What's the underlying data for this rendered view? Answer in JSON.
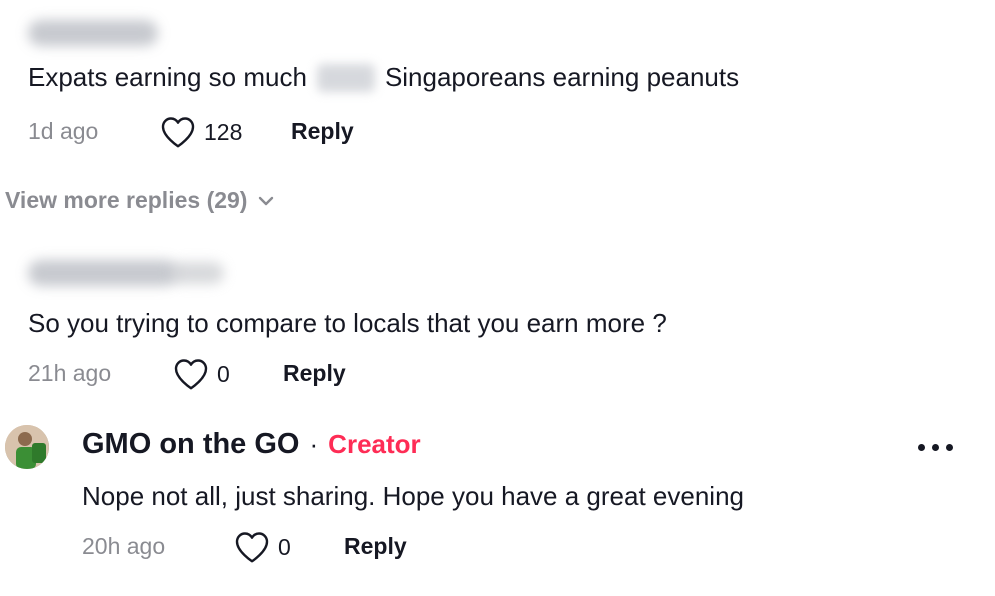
{
  "comment1": {
    "text_before": "Expats earning so much",
    "text_after": "Singaporeans earning peanuts",
    "time": "1d ago",
    "likes": "128",
    "reply_label": "Reply"
  },
  "view_more": {
    "label": "View more replies (29)"
  },
  "comment2": {
    "text": "So you trying to compare to locals that you earn more ?",
    "time": "21h ago",
    "likes": "0",
    "reply_label": "Reply"
  },
  "comment3": {
    "author": "GMO on the GO",
    "separator": "·",
    "badge": "Creator",
    "text": "Nope not all, just sharing. Hope you have a great evening",
    "time": "20h ago",
    "likes": "0",
    "reply_label": "Reply"
  },
  "icons": {
    "like": "heart-outline-icon",
    "expand": "chevron-down-icon",
    "more": "more-horizontal-icon"
  },
  "colors": {
    "creator_badge": "#fe2c55",
    "muted_text": "#8a8b91",
    "primary_text": "#161823"
  }
}
